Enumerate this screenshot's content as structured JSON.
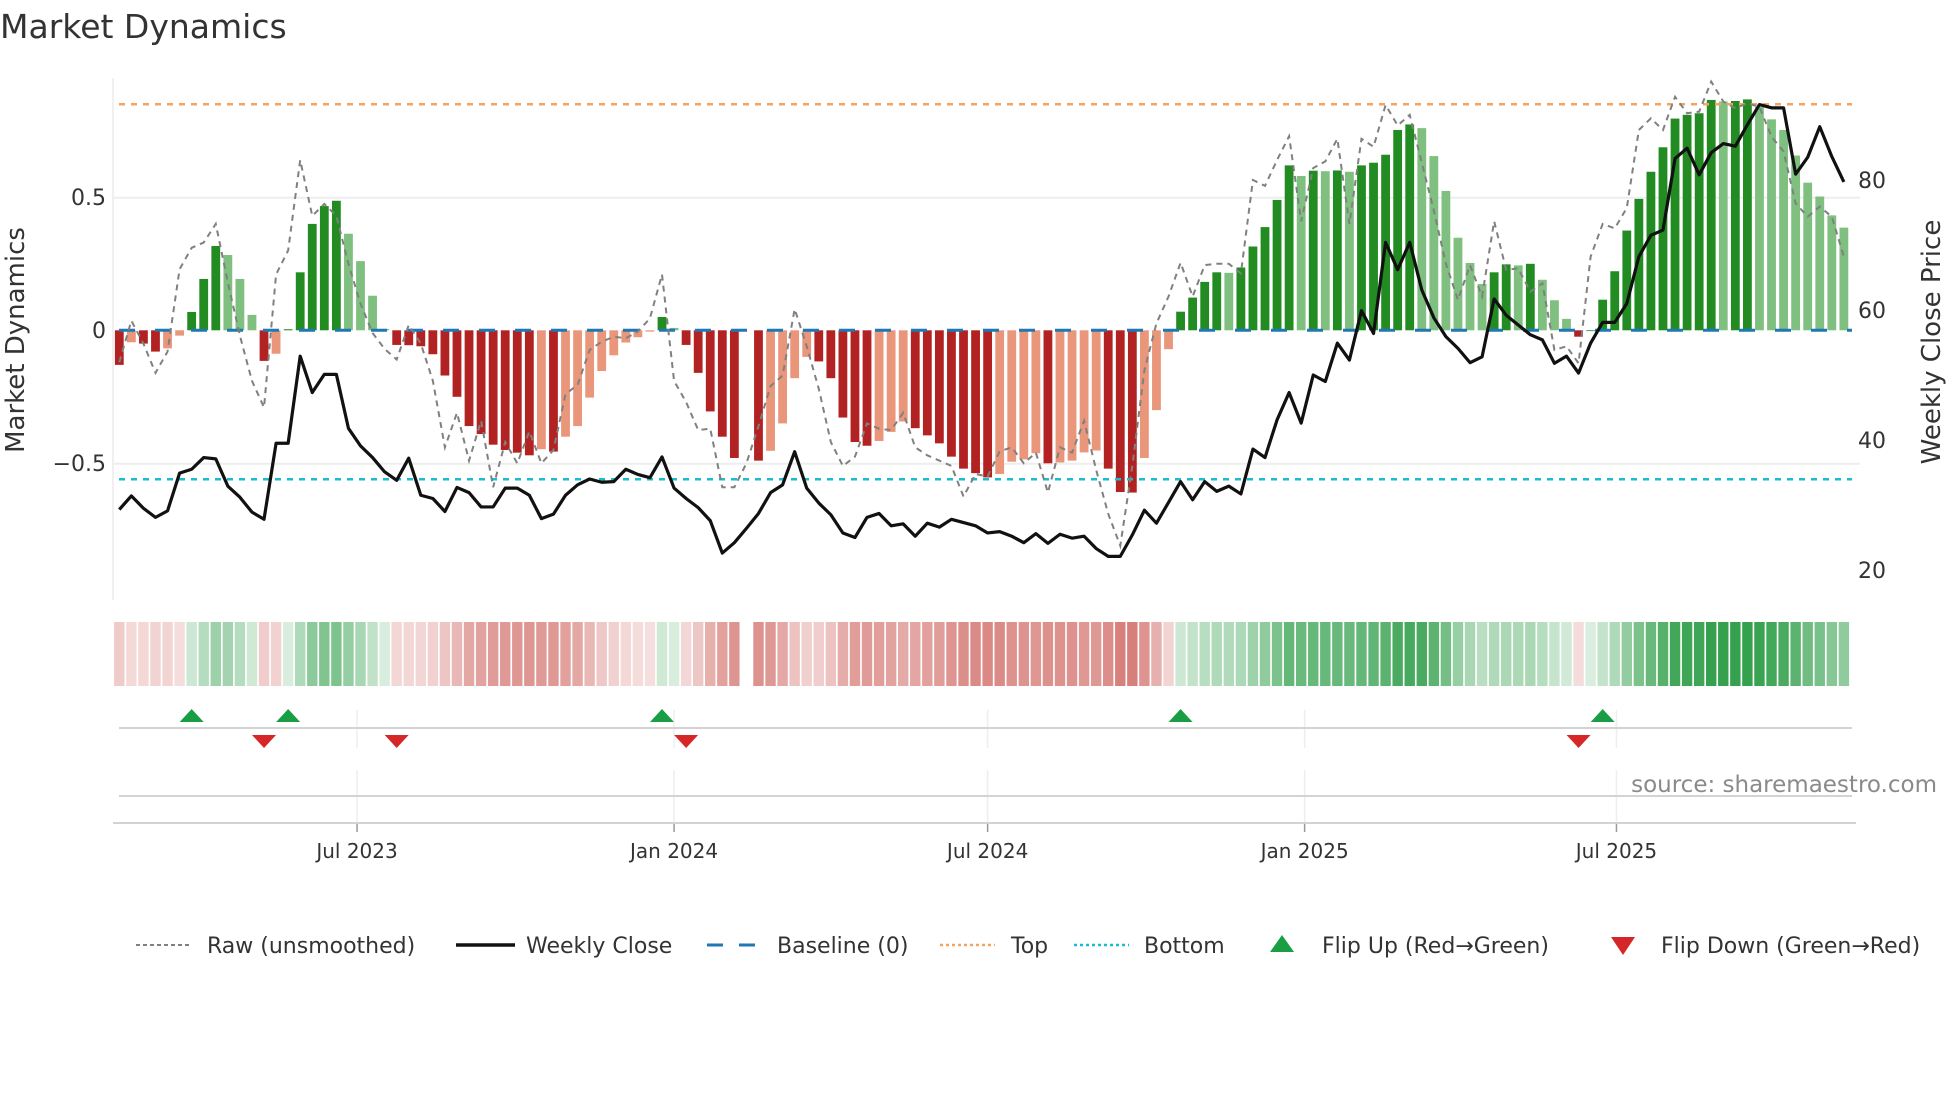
{
  "chart_data": {
    "type": "bar",
    "title": "Market Dynamics",
    "ylabel": "Market Dynamics",
    "ylabel_right": "Weekly Close Price",
    "x_start": "2023-02-13",
    "x_frequency": "weekly",
    "ylim": [
      -0.95,
      0.95
    ],
    "ylim_right": [
      20,
      95
    ],
    "yticks": [
      {
        "value": 0.5,
        "label": "0.5"
      },
      {
        "value": 0,
        "label": "0"
      },
      {
        "value": -0.5,
        "label": "−0.5"
      }
    ],
    "yticks_right": [
      {
        "value": 80,
        "label": "80"
      },
      {
        "value": 60,
        "label": "60"
      },
      {
        "value": 40,
        "label": "40"
      },
      {
        "value": 20,
        "label": "20"
      }
    ],
    "xticks": [
      {
        "date": "2023-07-01",
        "label": "Jul 2023"
      },
      {
        "date": "2024-01-01",
        "label": "Jan 2024"
      },
      {
        "date": "2024-07-01",
        "label": "Jul 2024"
      },
      {
        "date": "2025-01-01",
        "label": "Jan 2025"
      },
      {
        "date": "2025-07-01",
        "label": "Jul 2025"
      }
    ],
    "top_level": 0.85,
    "bottom_level": -0.56,
    "baseline": 0,
    "series": [
      {
        "name": "Market Dynamics (smoothed)",
        "values": [
          -0.13,
          -0.045,
          -0.05,
          -0.08,
          -0.068,
          -0.02,
          0.069,
          0.193,
          0.317,
          0.283,
          0.193,
          0.058,
          -0.115,
          -0.088,
          0.004,
          0.218,
          0.4,
          0.467,
          0.487,
          0.363,
          0.26,
          0.13,
          0.005,
          -0.055,
          -0.056,
          -0.06,
          -0.09,
          -0.17,
          -0.25,
          -0.36,
          -0.39,
          -0.43,
          -0.45,
          -0.46,
          -0.47,
          -0.447,
          -0.456,
          -0.4,
          -0.36,
          -0.253,
          -0.153,
          -0.094,
          -0.046,
          -0.026,
          -0.005,
          0.05,
          0.009,
          -0.055,
          -0.16,
          -0.305,
          -0.4,
          -0.48,
          null,
          -0.49,
          -0.453,
          -0.35,
          -0.18,
          -0.1,
          -0.117,
          -0.18,
          -0.328,
          -0.42,
          -0.434,
          -0.416,
          -0.382,
          -0.343,
          -0.368,
          -0.395,
          -0.425,
          -0.475,
          -0.52,
          -0.537,
          -0.553,
          -0.54,
          -0.494,
          -0.485,
          -0.462,
          -0.5,
          -0.497,
          -0.49,
          -0.459,
          -0.452,
          -0.52,
          -0.608,
          -0.61,
          -0.48,
          -0.3,
          -0.071,
          0.07,
          0.123,
          0.182,
          0.218,
          0.216,
          0.236,
          0.315,
          0.388,
          0.49,
          0.62,
          0.58,
          0.6,
          0.598,
          0.601,
          0.596,
          0.62,
          0.63,
          0.66,
          0.753,
          0.774,
          0.76,
          0.655,
          0.524,
          0.348,
          0.253,
          0.174,
          0.218,
          0.248,
          0.244,
          0.25,
          0.19,
          0.113,
          0.043,
          -0.024,
          0,
          0.115,
          0.222,
          0.375,
          0.494,
          0.596,
          0.688,
          0.796,
          0.81,
          0.816,
          0.866,
          0.86,
          0.862,
          0.868,
          0.84,
          0.793,
          0.753,
          0.657,
          0.555,
          0.503,
          0.432,
          0.386
        ]
      },
      {
        "name": "Raw (unsmoothed)",
        "values": [
          -0.12,
          0.036,
          -0.05,
          -0.16,
          -0.08,
          0.23,
          0.31,
          0.33,
          0.4,
          0.18,
          -0.02,
          -0.19,
          -0.29,
          0.21,
          0.3,
          0.64,
          0.43,
          0.475,
          0.43,
          0.25,
          0.1,
          -0.01,
          -0.07,
          -0.11,
          0.02,
          -0.05,
          -0.19,
          -0.44,
          -0.31,
          -0.49,
          -0.34,
          -0.59,
          -0.42,
          -0.5,
          -0.38,
          -0.5,
          -0.45,
          -0.24,
          -0.205,
          -0.074,
          -0.043,
          -0.024,
          -0.03,
          -0.005,
          0.045,
          0.21,
          -0.19,
          -0.27,
          -0.375,
          -0.37,
          -0.59,
          -0.59,
          -0.5,
          -0.36,
          -0.21,
          -0.17,
          0.08,
          -0.06,
          -0.22,
          -0.42,
          -0.51,
          -0.475,
          -0.35,
          -0.37,
          -0.375,
          -0.31,
          -0.44,
          -0.47,
          -0.49,
          -0.51,
          -0.625,
          -0.54,
          -0.55,
          -0.455,
          -0.44,
          -0.5,
          -0.46,
          -0.61,
          -0.44,
          -0.46,
          -0.34,
          -0.525,
          -0.69,
          -0.81,
          -0.51,
          -0.15,
          0.026,
          0.127,
          0.254,
          0.127,
          0.245,
          0.25,
          0.25,
          0.214,
          0.565,
          0.543,
          0.64,
          0.73,
          0.41,
          0.61,
          0.635,
          0.72,
          0.4,
          0.72,
          0.69,
          0.847,
          0.77,
          0.81,
          0.63,
          0.45,
          0.25,
          0.114,
          0.245,
          0.127,
          0.41,
          0.227,
          0.233,
          0.145,
          0.177,
          -0.074,
          -0.06,
          -0.124,
          0.277,
          0.4,
          0.383,
          0.46,
          0.753,
          0.797,
          0.753,
          0.878,
          0.816,
          0.822,
          0.935,
          0.86,
          0.835,
          0.853,
          0.84,
          0.728,
          0.672,
          0.477,
          0.427,
          0.465,
          0.427,
          0.277
        ]
      },
      {
        "name": "Weekly Close",
        "axis": "right",
        "values": [
          29.3,
          31.4,
          29.5,
          28.1,
          29.1,
          34.9,
          35.5,
          37.3,
          37.1,
          32.9,
          31.2,
          28.9,
          27.8,
          39.5,
          39.5,
          52.9,
          47.3,
          50.1,
          50.1,
          41.8,
          39.1,
          37.3,
          35.1,
          33.8,
          37.2,
          31.5,
          31.0,
          29.0,
          32.7,
          31.9,
          29.7,
          29.7,
          32.6,
          32.6,
          31.5,
          27.9,
          28.6,
          31.5,
          33.1,
          34.0,
          33.5,
          33.6,
          35.5,
          34.7,
          34.2,
          37.4,
          32.6,
          31.0,
          29.6,
          27.6,
          22.6,
          24.2,
          26.4,
          28.7,
          31.9,
          33.1,
          38.2,
          32.6,
          30.3,
          28.5,
          25.7,
          25.0,
          28.1,
          28.7,
          26.8,
          27.1,
          25.2,
          27.2,
          26.6,
          27.8,
          27.3,
          26.8,
          25.7,
          25.9,
          25.2,
          24.2,
          25.6,
          24.1,
          25.5,
          24.9,
          25.2,
          23.3,
          22.1,
          22.1,
          25.4,
          29.2,
          27.2,
          30.4,
          33.6,
          30.8,
          33.6,
          32.1,
          32.9,
          31.7,
          38.6,
          37.3,
          43.1,
          47.3,
          42.6,
          50.0,
          49.0,
          54.9,
          52.3,
          59.9,
          56.4,
          70.4,
          66.2,
          70.4,
          63.1,
          58.8,
          55.9,
          54.1,
          51.9,
          52.8,
          61.7,
          59.2,
          57.7,
          56.2,
          55.4,
          51.8,
          52.9,
          50.3,
          54.9,
          58.1,
          58.1,
          61.0,
          68.2,
          71.5,
          72.3,
          83.3,
          84.9,
          80.8,
          84.2,
          85.6,
          85.2,
          88.5,
          91.6,
          91.1,
          91.1,
          80.9,
          83.5,
          88.2,
          83.6,
          79.7
        ]
      }
    ],
    "flip_up_weeks": [
      6,
      14,
      45,
      88,
      123
    ],
    "flip_down_weeks": [
      12,
      23,
      47,
      121
    ],
    "legend": {
      "placement": "bottom",
      "raw": "Raw (unsmoothed)",
      "close": "Weekly Close",
      "baseline": "Baseline (0)",
      "top": "Top",
      "bottom": "Bottom",
      "flip_up": "Flip Up (Red→Green)",
      "flip_down": "Flip Down (Green→Red)"
    },
    "source": "source: sharemaestro.com",
    "colors": {
      "pos_strong": "#228b22",
      "pos_weak": "#7fbf7f",
      "neg_strong": "#b22222",
      "neg_weak": "#e9967a",
      "close": "#111111",
      "raw": "#808080",
      "baseline": "#1f77b4",
      "top": "#f4a460",
      "bottom": "#17becf",
      "flip_up": "#1a9e45",
      "flip_down": "#d62728",
      "strip_pos": "#2e9e48",
      "strip_neg": "#c9524c"
    }
  }
}
